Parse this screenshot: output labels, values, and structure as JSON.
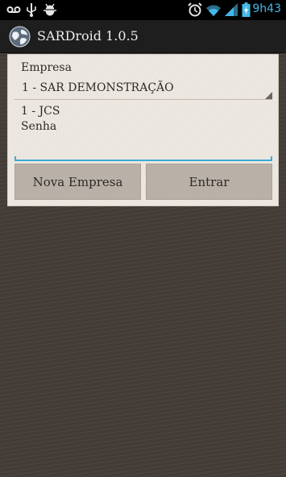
{
  "status_bar": {
    "time": "9h43",
    "icons": [
      "voicemail-icon",
      "usb-icon",
      "android-debug-icon",
      "alarm-clock-icon",
      "wifi-icon",
      "signal-icon",
      "battery-icon"
    ]
  },
  "app_bar": {
    "title": "SARDroid 1.0.5",
    "icon": "globe-icon"
  },
  "form": {
    "company_label": "Empresa",
    "company_selected": "1 - SAR DEMONSTRAÇÃO",
    "user_label": "1 - JCS",
    "password_label": "Senha",
    "password_value": ""
  },
  "buttons": {
    "new_company": "Nova Empresa",
    "login": "Entrar"
  },
  "colors": {
    "accent": "#3fa9d7",
    "clock": "#43b8e8",
    "background": "#443d37",
    "panel": "#ece7df",
    "button": "#b9b1a8"
  }
}
